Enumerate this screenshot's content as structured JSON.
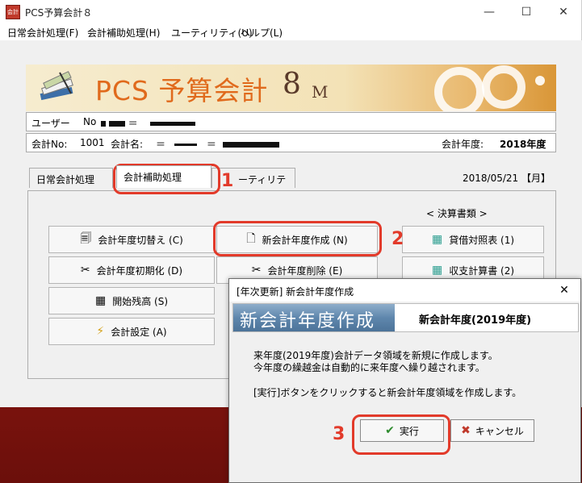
{
  "window": {
    "title": "PCS予算会計８",
    "app_icon_text": "会計"
  },
  "menu": [
    "日常会計処理(F)",
    "会計補助処理(H)",
    "ユーティリティ(U)",
    "ヘルプ(L)"
  ],
  "banner": {
    "title": "PCS 予算会計",
    "version": "8",
    "suffix": "M"
  },
  "user": {
    "label": "ユーザー",
    "no_label": "No"
  },
  "account": {
    "no_label": "会計No:",
    "no": "1001",
    "name_label": "会計名:",
    "year_label": "会計年度:",
    "year": "2018年度"
  },
  "tabs": [
    "日常会計処理",
    "会計補助処理",
    "ーティリティ"
  ],
  "date": "2018/05/21 【月】",
  "buttons": {
    "year_switch": "会計年度切替え (C)",
    "new_year": "新会計年度作成 (N)",
    "init_year": "会計年度初期化 (D)",
    "delete_year": "会計年度削除 (E)",
    "opening_balance": "開始残高 (S)",
    "settings": "会計設定 (A)",
    "balance_sheet": "貸借対照表 (1)",
    "income_statement": "収支計算書 (2)"
  },
  "section_label": "< 決算書類 >",
  "callouts": [
    "1",
    "2",
    "3"
  ],
  "dialog": {
    "title": "[年次更新] 新会計年度作成",
    "header_title": "新会計年度作成",
    "header_year": "新会計年度(2019年度)",
    "msg1": "来年度(2019年度)会計データ領域を新規に作成します。",
    "msg2": "今年度の繰越金は自動的に来年度へ繰り越されます。",
    "msg3": "[実行]ボタンをクリックすると新会計年度領域を作成します。",
    "execute": "実行",
    "cancel": "キャンセル"
  },
  "colors": {
    "accent": "#e23a2a",
    "banner_title": "#e06a1c",
    "background": "#a11c14"
  }
}
